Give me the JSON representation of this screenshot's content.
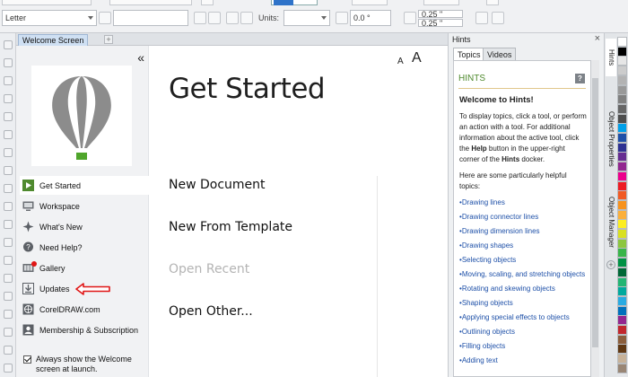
{
  "property_bar": {
    "page_size": "Letter",
    "units_label": "Units:",
    "rotation": "0.0 °",
    "nudge_x": "0.25 \"",
    "nudge_y": "0.25 \""
  },
  "document_tab": {
    "label": "Welcome Screen",
    "add_symbol": "+"
  },
  "welcome": {
    "collapse_symbol": "«",
    "font_small": "A",
    "font_large": "A",
    "title": "Get Started",
    "nav": [
      {
        "label": "Get Started",
        "icon": "play-icon",
        "active": true
      },
      {
        "label": "Workspace",
        "icon": "monitor-icon"
      },
      {
        "label": "What's New",
        "icon": "star-burst-icon"
      },
      {
        "label": "Need Help?",
        "icon": "help-bubble-icon"
      },
      {
        "label": "Gallery",
        "icon": "gallery-icon",
        "badge": true
      },
      {
        "label": "Updates",
        "icon": "download-icon"
      },
      {
        "label": "CorelDRAW.com",
        "icon": "globe-icon"
      },
      {
        "label": "Membership & Subscription",
        "icon": "membership-icon"
      }
    ],
    "always_show": "Always show the Welcome screen at launch.",
    "actions": {
      "new_document": "New Document",
      "new_from_template": "New From Template",
      "open_recent": "Open Recent",
      "open_other": "Open Other..."
    }
  },
  "hints_docker": {
    "title": "Hints",
    "close_symbol": "×",
    "tabs": [
      "Topics",
      "Videos"
    ],
    "heading": "HINTS",
    "help_symbol": "?",
    "welcome_title": "Welcome to Hints!",
    "intro_parts": {
      "a": "To display topics, click a tool, or perform an action with a tool. For additional information about the active tool, click the ",
      "help_word": "Help",
      "b": " button in the upper-right corner of the ",
      "hints_word": "Hints",
      "c": " docker."
    },
    "topics_intro": "Here are some particularly helpful topics:",
    "topics": [
      "Drawing lines",
      "Drawing connector lines",
      "Drawing dimension lines",
      "Drawing shapes",
      "Selecting objects",
      "Moving, scaling, and stretching objects",
      "Rotating and skewing objects",
      "Shaping objects",
      "Applying special effects to objects",
      "Outlining objects",
      "Filling objects",
      "Adding text"
    ]
  },
  "side_tabs": [
    "Hints",
    "Object Properties",
    "Object Manager"
  ],
  "colors": {
    "accent_green": "#4f8a2e",
    "arrow_red": "#e01616",
    "link_blue": "#1e50a8"
  },
  "palette": [
    "#ffffff",
    "#000000",
    "#e6e6e6",
    "#cccccc",
    "#b3b3b3",
    "#999999",
    "#808080",
    "#666666",
    "#4d4d4d",
    "#00a0e9",
    "#1e50a8",
    "#2e3192",
    "#662d91",
    "#92278f",
    "#ec008c",
    "#ed1c24",
    "#f15a24",
    "#f7931e",
    "#fbb03b",
    "#fcee21",
    "#d9e021",
    "#8cc63f",
    "#39b54a",
    "#009245",
    "#006837",
    "#22b573",
    "#00a99d",
    "#29abe2",
    "#0071bc",
    "#93278f",
    "#c1272d",
    "#8b5e3c",
    "#603813",
    "#c7b299",
    "#998675"
  ]
}
